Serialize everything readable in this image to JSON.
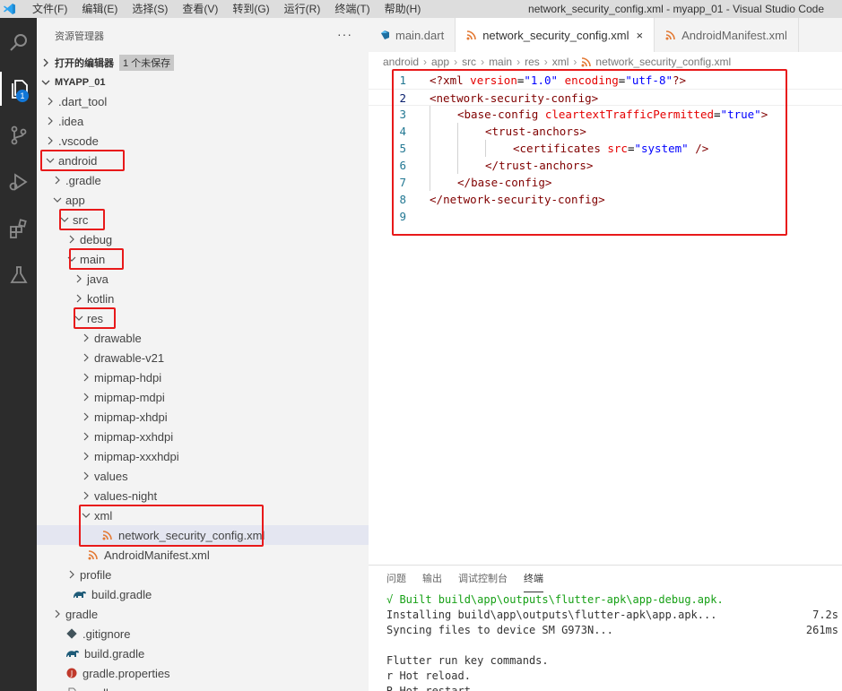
{
  "titlebar": {
    "menu": [
      "文件(F)",
      "编辑(E)",
      "选择(S)",
      "查看(V)",
      "转到(G)",
      "运行(R)",
      "终端(T)",
      "帮助(H)"
    ],
    "window_title": "network_security_config.xml - myapp_01 - Visual Studio Code"
  },
  "activity": {
    "explorer_badge": "1"
  },
  "sidebar": {
    "title": "资源管理器",
    "more": "···",
    "open_editors_label": "打开的编辑器",
    "unsaved_badge": "1 个未保存",
    "project_label": "MYAPP_01",
    "tree": [
      {
        "label": ".dart_tool",
        "depth": 1,
        "kind": "folder",
        "open": false
      },
      {
        "label": ".idea",
        "depth": 1,
        "kind": "folder",
        "open": false
      },
      {
        "label": ".vscode",
        "depth": 1,
        "kind": "folder",
        "open": false
      },
      {
        "label": "android",
        "depth": 1,
        "kind": "folder",
        "open": true
      },
      {
        "label": ".gradle",
        "depth": 2,
        "kind": "folder",
        "open": false
      },
      {
        "label": "app",
        "depth": 2,
        "kind": "folder",
        "open": true
      },
      {
        "label": "src",
        "depth": 3,
        "kind": "folder",
        "open": true
      },
      {
        "label": "debug",
        "depth": 4,
        "kind": "folder",
        "open": false
      },
      {
        "label": "main",
        "depth": 4,
        "kind": "folder",
        "open": true
      },
      {
        "label": "java",
        "depth": 5,
        "kind": "folder",
        "open": false
      },
      {
        "label": "kotlin",
        "depth": 5,
        "kind": "folder",
        "open": false
      },
      {
        "label": "res",
        "depth": 5,
        "kind": "folder",
        "open": true
      },
      {
        "label": "drawable",
        "depth": 6,
        "kind": "folder",
        "open": false
      },
      {
        "label": "drawable-v21",
        "depth": 6,
        "kind": "folder",
        "open": false
      },
      {
        "label": "mipmap-hdpi",
        "depth": 6,
        "kind": "folder",
        "open": false
      },
      {
        "label": "mipmap-mdpi",
        "depth": 6,
        "kind": "folder",
        "open": false
      },
      {
        "label": "mipmap-xhdpi",
        "depth": 6,
        "kind": "folder",
        "open": false
      },
      {
        "label": "mipmap-xxhdpi",
        "depth": 6,
        "kind": "folder",
        "open": false
      },
      {
        "label": "mipmap-xxxhdpi",
        "depth": 6,
        "kind": "folder",
        "open": false
      },
      {
        "label": "values",
        "depth": 6,
        "kind": "folder",
        "open": false
      },
      {
        "label": "values-night",
        "depth": 6,
        "kind": "folder",
        "open": false
      },
      {
        "label": "xml",
        "depth": 6,
        "kind": "folder",
        "open": true
      },
      {
        "label": "network_security_config.xml",
        "depth": 7,
        "kind": "xml",
        "selected": true
      },
      {
        "label": "AndroidManifest.xml",
        "depth": 5,
        "kind": "xml"
      },
      {
        "label": "profile",
        "depth": 4,
        "kind": "folder",
        "open": false
      },
      {
        "label": "build.gradle",
        "depth": 3,
        "kind": "gradle"
      },
      {
        "label": "gradle",
        "depth": 2,
        "kind": "folder",
        "open": false
      },
      {
        "label": ".gitignore",
        "depth": 2,
        "kind": "git"
      },
      {
        "label": "build.gradle",
        "depth": 2,
        "kind": "gradle"
      },
      {
        "label": "gradle.properties",
        "depth": 2,
        "kind": "props"
      },
      {
        "label": "gradlew",
        "depth": 2,
        "kind": "file"
      }
    ]
  },
  "tabs": [
    {
      "label": "main.dart",
      "icon": "dart-icon",
      "active": false
    },
    {
      "label": "network_security_config.xml",
      "icon": "rss-icon",
      "active": true,
      "close": "×"
    },
    {
      "label": "AndroidManifest.xml",
      "icon": "rss-icon",
      "active": false
    }
  ],
  "breadcrumb": [
    "android",
    "app",
    "src",
    "main",
    "res",
    "xml",
    "network_security_config.xml"
  ],
  "code": [
    {
      "n": "1",
      "indent": 0,
      "tokens": [
        [
          "pun",
          "<?"
        ],
        [
          "tag",
          "xml"
        ],
        [
          "plain",
          " "
        ],
        [
          "attr",
          "version"
        ],
        [
          "plain",
          "="
        ],
        [
          "val",
          "\"1.0\""
        ],
        [
          "plain",
          " "
        ],
        [
          "attr",
          "encoding"
        ],
        [
          "plain",
          "="
        ],
        [
          "val",
          "\"utf-8\""
        ],
        [
          "pun",
          "?>"
        ]
      ]
    },
    {
      "n": "2",
      "indent": 0,
      "tokens": [
        [
          "pun",
          "<"
        ],
        [
          "tag",
          "network-security-config"
        ],
        [
          "pun",
          ">"
        ]
      ]
    },
    {
      "n": "3",
      "indent": 1,
      "tokens": [
        [
          "pun",
          "<"
        ],
        [
          "tag",
          "base-config"
        ],
        [
          "plain",
          " "
        ],
        [
          "attr",
          "cleartextTrafficPermitted"
        ],
        [
          "plain",
          "="
        ],
        [
          "val",
          "\"true\""
        ],
        [
          "pun",
          ">"
        ]
      ]
    },
    {
      "n": "4",
      "indent": 2,
      "tokens": [
        [
          "pun",
          "<"
        ],
        [
          "tag",
          "trust-anchors"
        ],
        [
          "pun",
          ">"
        ]
      ]
    },
    {
      "n": "5",
      "indent": 3,
      "tokens": [
        [
          "pun",
          "<"
        ],
        [
          "tag",
          "certificates"
        ],
        [
          "plain",
          " "
        ],
        [
          "attr",
          "src"
        ],
        [
          "plain",
          "="
        ],
        [
          "val",
          "\"system\""
        ],
        [
          "plain",
          " "
        ],
        [
          "pun",
          "/>"
        ]
      ]
    },
    {
      "n": "6",
      "indent": 2,
      "tokens": [
        [
          "pun",
          "</"
        ],
        [
          "tag",
          "trust-anchors"
        ],
        [
          "pun",
          ">"
        ]
      ]
    },
    {
      "n": "7",
      "indent": 1,
      "tokens": [
        [
          "pun",
          "</"
        ],
        [
          "tag",
          "base-config"
        ],
        [
          "pun",
          ">"
        ]
      ]
    },
    {
      "n": "8",
      "indent": 0,
      "tokens": [
        [
          "pun",
          "</"
        ],
        [
          "tag",
          "network-security-config"
        ],
        [
          "pun",
          ">"
        ]
      ]
    },
    {
      "n": "9",
      "indent": 0,
      "tokens": []
    }
  ],
  "panel": {
    "tabs": [
      "问题",
      "输出",
      "调试控制台",
      "终端"
    ],
    "active_tab": "终端",
    "lines": [
      {
        "text": "√ Built build\\app\\outputs\\flutter-apk\\app-debug.apk.",
        "right": "",
        "green": true
      },
      {
        "text": "Installing build\\app\\outputs\\flutter-apk\\app.apk...",
        "right": "7.2s"
      },
      {
        "text": "Syncing files to device SM G973N...",
        "right": "261ms"
      },
      {
        "text": "",
        "right": ""
      },
      {
        "text": "Flutter run key commands.",
        "right": ""
      },
      {
        "text": "r Hot reload.",
        "right": ""
      },
      {
        "text": "R Hot restart.",
        "right": ""
      }
    ]
  },
  "colors": {
    "highlight": "#e8191a",
    "activity_bg": "#2c2c2c",
    "sidebar_bg": "#f3f3f3",
    "accent": "#1177d8"
  }
}
